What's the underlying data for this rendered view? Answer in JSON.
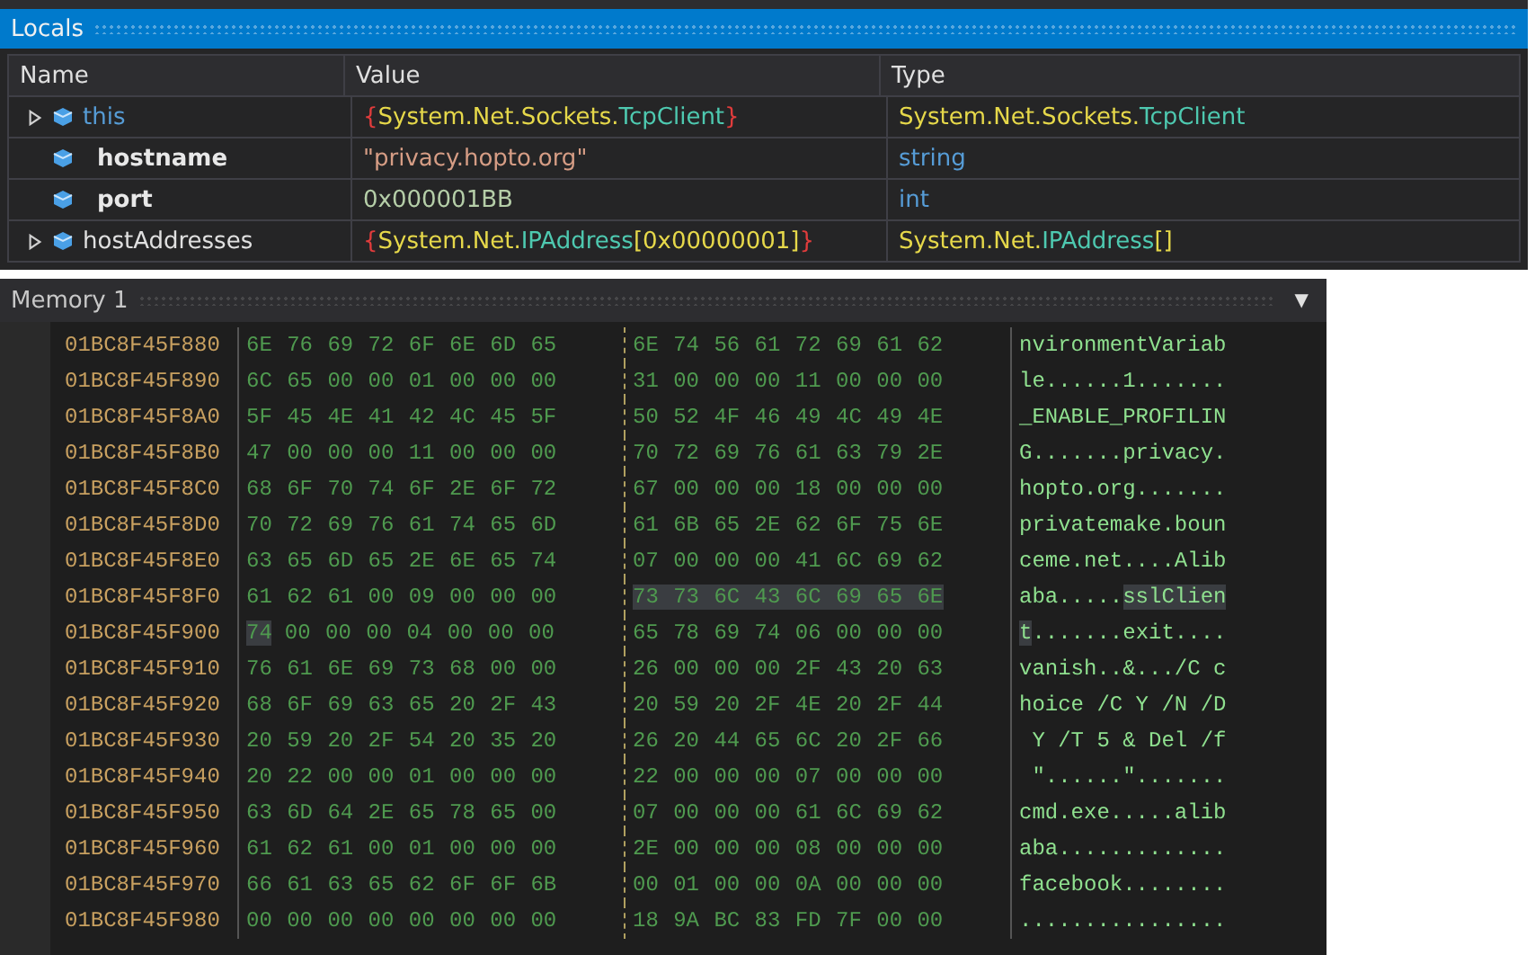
{
  "locals": {
    "title": "Locals",
    "columns": [
      "Name",
      "Value",
      "Type"
    ],
    "rows": [
      {
        "expandable": true,
        "name": "this",
        "kind": "keyword",
        "value": [
          {
            "text": "{",
            "kind": "brace"
          },
          {
            "text": "System.Net.Sockets.",
            "kind": "namespace"
          },
          {
            "text": "TcpClient",
            "kind": "class"
          },
          {
            "text": "}",
            "kind": "brace"
          }
        ],
        "type": [
          {
            "text": "System.Net.Sockets.",
            "kind": "namespace"
          },
          {
            "text": "TcpClient",
            "kind": "class"
          }
        ]
      },
      {
        "expandable": false,
        "name": "hostname",
        "kind": "bold",
        "value": [
          {
            "text": "\"privacy.hopto.org\"",
            "kind": "string"
          }
        ],
        "type": [
          {
            "text": "string",
            "kind": "keyword"
          }
        ]
      },
      {
        "expandable": false,
        "name": "port",
        "kind": "bold",
        "value": [
          {
            "text": "0x000001BB",
            "kind": "number"
          }
        ],
        "type": [
          {
            "text": "int",
            "kind": "keyword"
          }
        ]
      },
      {
        "expandable": true,
        "name": "hostAddresses",
        "kind": "plain",
        "value": [
          {
            "text": "{",
            "kind": "brace"
          },
          {
            "text": "System.Net.",
            "kind": "namespace"
          },
          {
            "text": "IPAddress",
            "kind": "class"
          },
          {
            "text": "[0x00000001]",
            "kind": "namespace"
          },
          {
            "text": "}",
            "kind": "brace"
          }
        ],
        "type": [
          {
            "text": "System.Net.",
            "kind": "namespace"
          },
          {
            "text": "IPAddress",
            "kind": "class"
          },
          {
            "text": "[]",
            "kind": "namespace"
          }
        ]
      }
    ]
  },
  "memory": {
    "title": "Memory 1",
    "dropdown": "▼",
    "rows": [
      {
        "address": "01BC8F45F880",
        "left": [
          {
            "text": "6E 76 69 72 6F 6E 6D 65",
            "selected": false
          }
        ],
        "right": [
          {
            "text": "6E 74 56 61 72 69 61 62",
            "selected": false
          }
        ],
        "ascii": [
          {
            "text": "nvironmentVariab",
            "selected": false
          }
        ]
      },
      {
        "address": "01BC8F45F890",
        "left": [
          {
            "text": "6C 65 00 00 01 00 00 00",
            "selected": false
          }
        ],
        "right": [
          {
            "text": "31 00 00 00 11 00 00 00",
            "selected": false
          }
        ],
        "ascii": [
          {
            "text": "le......1.......",
            "selected": false
          }
        ]
      },
      {
        "address": "01BC8F45F8A0",
        "left": [
          {
            "text": "5F 45 4E 41 42 4C 45 5F",
            "selected": false
          }
        ],
        "right": [
          {
            "text": "50 52 4F 46 49 4C 49 4E",
            "selected": false
          }
        ],
        "ascii": [
          {
            "text": "_ENABLE_PROFILIN",
            "selected": false
          }
        ]
      },
      {
        "address": "01BC8F45F8B0",
        "left": [
          {
            "text": "47 00 00 00 11 00 00 00",
            "selected": false
          }
        ],
        "right": [
          {
            "text": "70 72 69 76 61 63 79 2E",
            "selected": false
          }
        ],
        "ascii": [
          {
            "text": "G.......privacy.",
            "selected": false
          }
        ]
      },
      {
        "address": "01BC8F45F8C0",
        "left": [
          {
            "text": "68 6F 70 74 6F 2E 6F 72",
            "selected": false
          }
        ],
        "right": [
          {
            "text": "67 00 00 00 18 00 00 00",
            "selected": false
          }
        ],
        "ascii": [
          {
            "text": "hopto.org.......",
            "selected": false
          }
        ]
      },
      {
        "address": "01BC8F45F8D0",
        "left": [
          {
            "text": "70 72 69 76 61 74 65 6D",
            "selected": false
          }
        ],
        "right": [
          {
            "text": "61 6B 65 2E 62 6F 75 6E",
            "selected": false
          }
        ],
        "ascii": [
          {
            "text": "privatemake.boun",
            "selected": false
          }
        ]
      },
      {
        "address": "01BC8F45F8E0",
        "left": [
          {
            "text": "63 65 6D 65 2E 6E 65 74",
            "selected": false
          }
        ],
        "right": [
          {
            "text": "07 00 00 00 41 6C 69 62",
            "selected": false
          }
        ],
        "ascii": [
          {
            "text": "ceme.net....Alib",
            "selected": false
          }
        ]
      },
      {
        "address": "01BC8F45F8F0",
        "left": [
          {
            "text": "61 62 61 00 09 00 00 00",
            "selected": false
          }
        ],
        "right": [
          {
            "text": "73 73 6C 43 6C 69 65 6E",
            "selected": true
          }
        ],
        "ascii": [
          {
            "text": "aba.....",
            "selected": false
          },
          {
            "text": "sslClien",
            "selected": true
          }
        ]
      },
      {
        "address": "01BC8F45F900",
        "left": [
          {
            "text": "74",
            "selected": true
          },
          {
            "text": "00 00 00 04 00 00 00",
            "selected": false
          }
        ],
        "right": [
          {
            "text": "65 78 69 74 06 00 00 00",
            "selected": false
          }
        ],
        "ascii": [
          {
            "text": "t",
            "selected": true
          },
          {
            "text": ".......exit....",
            "selected": false
          }
        ]
      },
      {
        "address": "01BC8F45F910",
        "left": [
          {
            "text": "76 61 6E 69 73 68 00 00",
            "selected": false
          }
        ],
        "right": [
          {
            "text": "26 00 00 00 2F 43 20 63",
            "selected": false
          }
        ],
        "ascii": [
          {
            "text": "vanish..&.../C c",
            "selected": false
          }
        ]
      },
      {
        "address": "01BC8F45F920",
        "left": [
          {
            "text": "68 6F 69 63 65 20 2F 43",
            "selected": false
          }
        ],
        "right": [
          {
            "text": "20 59 20 2F 4E 20 2F 44",
            "selected": false
          }
        ],
        "ascii": [
          {
            "text": "hoice /C Y /N /D",
            "selected": false
          }
        ]
      },
      {
        "address": "01BC8F45F930",
        "left": [
          {
            "text": "20 59 20 2F 54 20 35 20",
            "selected": false
          }
        ],
        "right": [
          {
            "text": "26 20 44 65 6C 20 2F 66",
            "selected": false
          }
        ],
        "ascii": [
          {
            "text": " Y /T 5 & Del /f",
            "selected": false
          }
        ]
      },
      {
        "address": "01BC8F45F940",
        "left": [
          {
            "text": "20 22 00 00 01 00 00 00",
            "selected": false
          }
        ],
        "right": [
          {
            "text": "22 00 00 00 07 00 00 00",
            "selected": false
          }
        ],
        "ascii": [
          {
            "text": " \"......\".......",
            "selected": false
          }
        ]
      },
      {
        "address": "01BC8F45F950",
        "left": [
          {
            "text": "63 6D 64 2E 65 78 65 00",
            "selected": false
          }
        ],
        "right": [
          {
            "text": "07 00 00 00 61 6C 69 62",
            "selected": false
          }
        ],
        "ascii": [
          {
            "text": "cmd.exe.....alib",
            "selected": false
          }
        ]
      },
      {
        "address": "01BC8F45F960",
        "left": [
          {
            "text": "61 62 61 00 01 00 00 00",
            "selected": false
          }
        ],
        "right": [
          {
            "text": "2E 00 00 00 08 00 00 00",
            "selected": false
          }
        ],
        "ascii": [
          {
            "text": "aba.............",
            "selected": false
          }
        ]
      },
      {
        "address": "01BC8F45F970",
        "left": [
          {
            "text": "66 61 63 65 62 6F 6F 6B",
            "selected": false
          }
        ],
        "right": [
          {
            "text": "00 01 00 00 0A 00 00 00",
            "selected": false
          }
        ],
        "ascii": [
          {
            "text": "facebook........",
            "selected": false
          }
        ]
      },
      {
        "address": "01BC8F45F980",
        "left": [
          {
            "text": "00 00 00 00 00 00 00 00",
            "selected": false
          }
        ],
        "right": [
          {
            "text": "18 9A BC 83 FD 7F 00 00",
            "selected": false
          }
        ],
        "ascii": [
          {
            "text": "................",
            "selected": false
          }
        ]
      }
    ]
  }
}
